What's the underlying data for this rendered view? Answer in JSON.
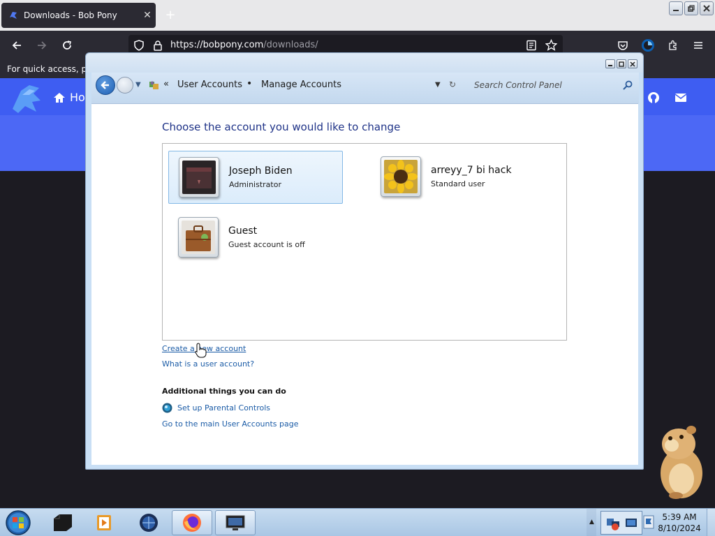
{
  "browser": {
    "tab_title": "Downloads - Bob Pony",
    "url_host": "https://bobpony.com",
    "url_path": "/downloads/",
    "bookmarks_text": "For quick access, plac"
  },
  "website": {
    "home_label": "Ho"
  },
  "control_panel": {
    "breadcrumb": [
      "User Accounts",
      "Manage Accounts"
    ],
    "search_placeholder": "Search Control Panel",
    "heading": "Choose the account you would like to change",
    "accounts": [
      {
        "name": "Joseph Biden",
        "role": "Administrator",
        "selected": true
      },
      {
        "name": "arreyy_7 bi hack",
        "role": "Standard user",
        "selected": false
      },
      {
        "name": "Guest",
        "role": "Guest account is off",
        "selected": false
      }
    ],
    "links": {
      "create_account": "Create a new account",
      "what_is": "What is a user account?"
    },
    "additional_heading": "Additional things you can do",
    "additional_links": {
      "parental": "Set up Parental Controls",
      "main_page": "Go to the main User Accounts page"
    }
  },
  "taskbar": {
    "time": "5:39 AM",
    "date": "8/10/2024"
  },
  "colors": {
    "link": "#1a5ba6",
    "heading": "#1e3287",
    "site_header": "#3e5df2"
  }
}
